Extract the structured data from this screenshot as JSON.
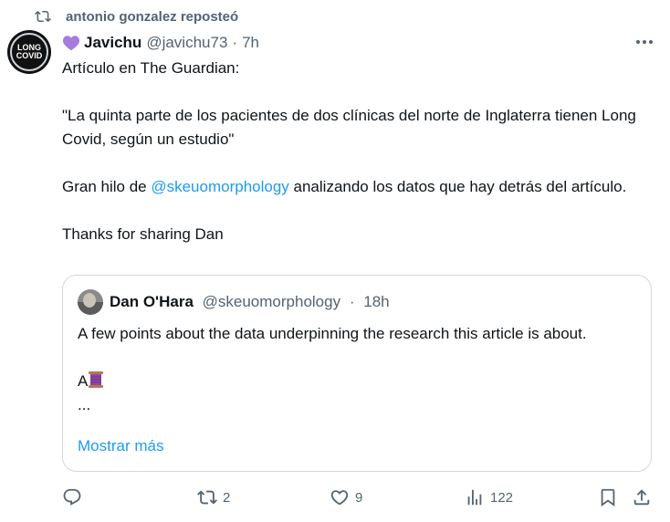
{
  "repost": {
    "text": "antonio gonzalez reposteó"
  },
  "tweet": {
    "author_name": "Javichu",
    "handle": "@javichu73",
    "separator": "·",
    "time": "7h",
    "avatar_text_line1": "LONG",
    "avatar_text_line2": "COVID",
    "body": {
      "line1": "Artículo en The Guardian:",
      "line2": "\"La quinta parte de los pacientes de dos clínicas del norte de Inglaterra tienen Long Covid, según un estudio\"",
      "line3_before": "Gran hilo de ",
      "line3_mention": "@skeuomorphology",
      "line3_after": " analizando los datos que hay detrás del artículo.",
      "line4": "Thanks for sharing Dan"
    }
  },
  "quote": {
    "author_name": "Dan O'Hara",
    "handle": "@skeuomorphology",
    "separator": "·",
    "time": "18h",
    "line1": "A few points about the data underpinning the research this article is about.",
    "line2_prefix": "A",
    "line3": "...",
    "show_more": "Mostrar más"
  },
  "actions": {
    "replies": "",
    "reposts": "2",
    "likes": "9",
    "views": "122"
  },
  "colors": {
    "accent": "#1d9bf0",
    "muted": "#536471",
    "heart": "#a77bde"
  }
}
